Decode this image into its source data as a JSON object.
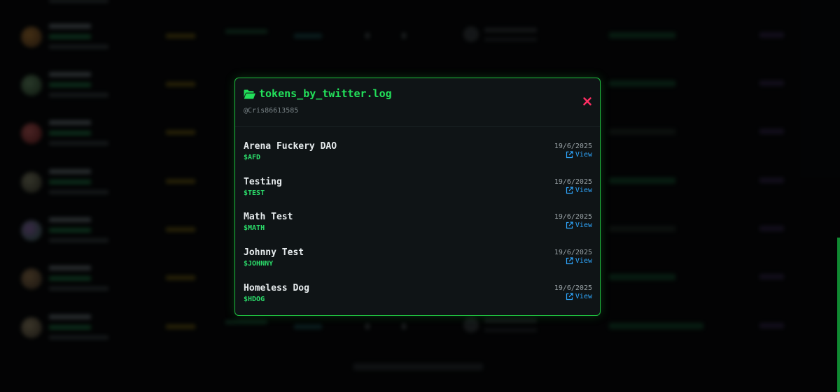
{
  "modal": {
    "title": "tokens_by_twitter.log",
    "subtitle": "@Cris86613585",
    "view_label": "View",
    "tokens": [
      {
        "name": "Arena Fuckery DAO",
        "symbol": "$AFD",
        "date": "19/6/2025"
      },
      {
        "name": "Testing",
        "symbol": "$TEST",
        "date": "19/6/2025"
      },
      {
        "name": "Math Test",
        "symbol": "$MATH",
        "date": "19/6/2025"
      },
      {
        "name": "Johnny Test",
        "symbol": "$JOHNNY",
        "date": "19/6/2025"
      },
      {
        "name": "Homeless Dog",
        "symbol": "$HDOG",
        "date": "19/6/2025"
      }
    ]
  },
  "colors": {
    "accent": "#22e05a",
    "border": "#1fbf3f",
    "close": "#ff2e63",
    "link": "#2fa8ff"
  },
  "icons": {
    "title": "folder-open-icon",
    "close": "close-icon",
    "view": "external-link-icon"
  }
}
